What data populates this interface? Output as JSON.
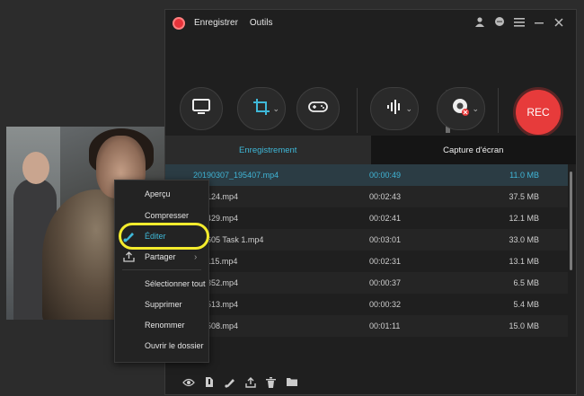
{
  "app": {
    "menus": [
      "Enregistrer",
      "Outils"
    ],
    "title_icons": [
      "user-icon",
      "chat-icon",
      "menu-icon",
      "minimize-icon",
      "close-icon"
    ],
    "accent": "#3fb8d8",
    "rec_color": "#e73b3b"
  },
  "toolbar": {
    "rec_label": "REC",
    "buttons": [
      "monitor-icon",
      "crop-icon",
      "gamepad-icon",
      "audio-icon",
      "webcam-icon"
    ],
    "extra": [
      "list-view-icon",
      "clock-icon",
      "alarm-icon"
    ]
  },
  "tabs": {
    "recording": "Enregistrement",
    "screenshot": "Capture d'écran"
  },
  "files": [
    {
      "name": "20190307_195407.mp4",
      "duration": "00:00:49",
      "size": "11.0 MB"
    },
    {
      "name": "192124.mp4",
      "duration": "00:02:43",
      "size": "37.5 MB"
    },
    {
      "name": "123429.mp4",
      "duration": "00:02:41",
      "size": "12.1 MB"
    },
    {
      "name": "123605 Task 1.mp4",
      "duration": "00:03:01",
      "size": "33.0 MB"
    },
    {
      "name": "123115.mp4",
      "duration": "00:02:31",
      "size": "13.1 MB"
    },
    {
      "name": "193352.mp4",
      "duration": "00:00:37",
      "size": "6.5 MB"
    },
    {
      "name": "192513.mp4",
      "duration": "00:00:32",
      "size": "5.4 MB"
    },
    {
      "name": "172508.mp4",
      "duration": "00:01:11",
      "size": "15.0 MB"
    },
    {
      "name": "",
      "duration": "",
      "size": ""
    }
  ],
  "context_menu": {
    "preview": "Aperçu",
    "compress": "Compresser",
    "edit": "Éditer",
    "share": "Partager",
    "select_all": "Sélectionner tout",
    "delete": "Supprimer",
    "rename": "Renommer",
    "open_folder": "Ouvrir le dossier"
  },
  "bottom_icons": [
    "eye-icon",
    "compress-icon",
    "edit-icon",
    "share-icon",
    "trash-icon",
    "folder-icon"
  ]
}
